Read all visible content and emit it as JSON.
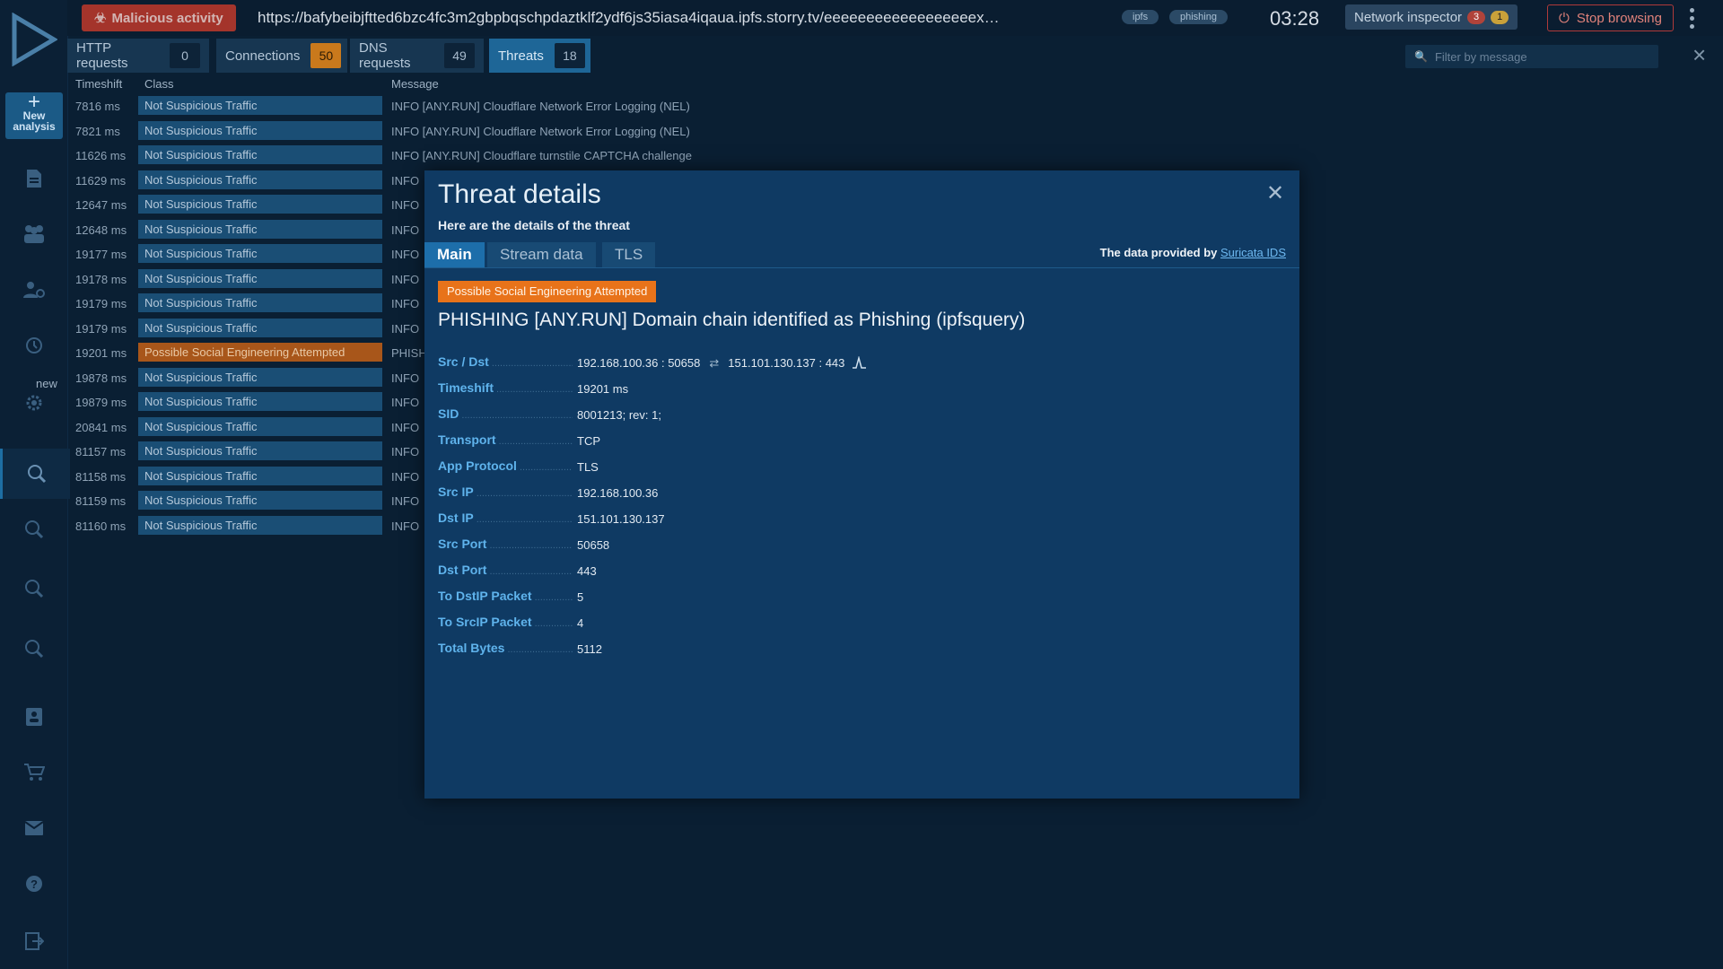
{
  "topbar": {
    "malicious_label": "Malicious activity",
    "url": "https://bafybeibjftted6bzc4fc3m2gbpbqschpdaztklf2ydf6js35iasa4iqaua.ipfs.storry.tv/eeeeeeeeeeeeeeeeeex…",
    "tags": [
      "ipfs",
      "phishing"
    ],
    "timer": "03:28",
    "network_inspector_label": "Network inspector",
    "network_inspector_red_count": "3",
    "network_inspector_yellow_count": "1",
    "stop_label": "Stop browsing"
  },
  "sidebar": {
    "new_analysis_line1": "New",
    "new_analysis_line2": "analysis",
    "new_tag": "new"
  },
  "tabs": [
    {
      "label": "HTTP requests",
      "count": "0"
    },
    {
      "label": "Connections",
      "count": "50"
    },
    {
      "label": "DNS requests",
      "count": "49"
    },
    {
      "label": "Threats",
      "count": "18"
    }
  ],
  "filter_placeholder": "Filter by message",
  "table": {
    "headers": [
      "Timeshift",
      "Class",
      "Message"
    ],
    "rows": [
      {
        "ts": "7816 ms",
        "cls": "Not Suspicious Traffic",
        "msg": "INFO [ANY.RUN] Cloudflare Network Error Logging (NEL)"
      },
      {
        "ts": "7821 ms",
        "cls": "Not Suspicious Traffic",
        "msg": "INFO [ANY.RUN] Cloudflare Network Error Logging (NEL)"
      },
      {
        "ts": "11626 ms",
        "cls": "Not Suspicious Traffic",
        "msg": "INFO [ANY.RUN] Cloudflare turnstile CAPTCHA challenge"
      },
      {
        "ts": "11629 ms",
        "cls": "Not Suspicious Traffic",
        "msg": "INFO"
      },
      {
        "ts": "12647 ms",
        "cls": "Not Suspicious Traffic",
        "msg": "INFO"
      },
      {
        "ts": "12648 ms",
        "cls": "Not Suspicious Traffic",
        "msg": "INFO"
      },
      {
        "ts": "19177 ms",
        "cls": "Not Suspicious Traffic",
        "msg": "INFO"
      },
      {
        "ts": "19178 ms",
        "cls": "Not Suspicious Traffic",
        "msg": "INFO"
      },
      {
        "ts": "19179 ms",
        "cls": "Not Suspicious Traffic",
        "msg": "INFO"
      },
      {
        "ts": "19179 ms",
        "cls": "Not Suspicious Traffic",
        "msg": "INFO"
      },
      {
        "ts": "19201 ms",
        "cls": "Possible Social Engineering Attempted",
        "msg": "PHISH"
      },
      {
        "ts": "19878 ms",
        "cls": "Not Suspicious Traffic",
        "msg": "INFO"
      },
      {
        "ts": "19879 ms",
        "cls": "Not Suspicious Traffic",
        "msg": "INFO"
      },
      {
        "ts": "20841 ms",
        "cls": "Not Suspicious Traffic",
        "msg": "INFO"
      },
      {
        "ts": "81157 ms",
        "cls": "Not Suspicious Traffic",
        "msg": "INFO"
      },
      {
        "ts": "81158 ms",
        "cls": "Not Suspicious Traffic",
        "msg": "INFO"
      },
      {
        "ts": "81159 ms",
        "cls": "Not Suspicious Traffic",
        "msg": "INFO"
      },
      {
        "ts": "81160 ms",
        "cls": "Not Suspicious Traffic",
        "msg": "INFO"
      }
    ]
  },
  "modal": {
    "title": "Threat details",
    "subtitle": "Here are the details of the threat",
    "tabs": [
      "Main",
      "Stream data",
      "TLS"
    ],
    "provided_prefix": "The data provided by",
    "provided_link": "Suricata IDS",
    "severity": "Possible Social Engineering Attempted",
    "headline": "PHISHING [ANY.RUN] Domain chain identified as Phishing (ipfsquery)",
    "src_dst_src": "192.168.100.36 : 50658",
    "src_dst_arrow": "⇄",
    "src_dst_dst": "151.101.130.137 : 443",
    "details": [
      {
        "k": "Src / Dst",
        "v": ""
      },
      {
        "k": "Timeshift",
        "v": "19201 ms"
      },
      {
        "k": "SID",
        "v": "8001213; rev: 1;"
      },
      {
        "k": "Transport",
        "v": "TCP"
      },
      {
        "k": "App Protocol",
        "v": "TLS"
      },
      {
        "k": "Src IP",
        "v": "192.168.100.36"
      },
      {
        "k": "Dst IP",
        "v": "151.101.130.137"
      },
      {
        "k": "Src Port",
        "v": "50658"
      },
      {
        "k": "Dst Port",
        "v": "443"
      },
      {
        "k": "To DstIP Packet",
        "v": "5"
      },
      {
        "k": "To SrcIP Packet",
        "v": "4"
      },
      {
        "k": "Total Bytes",
        "v": "5112"
      }
    ]
  },
  "colors": {
    "accent": "#1d6eaa",
    "malicious": "#c0392b",
    "orange": "#e8731a",
    "background": "#0a1f33"
  }
}
